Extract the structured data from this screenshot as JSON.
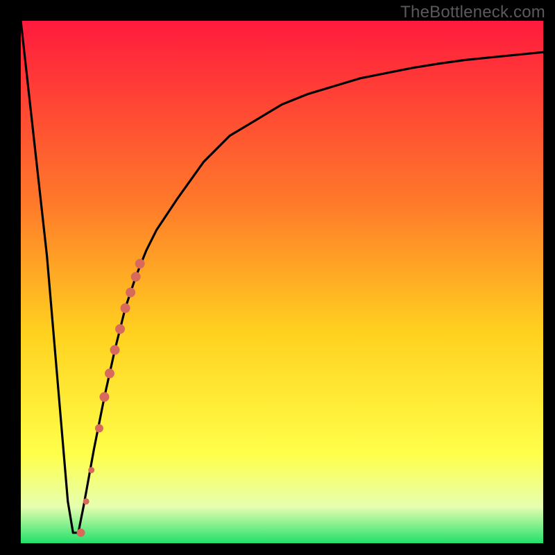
{
  "watermark": "TheBottleneck.com",
  "colors": {
    "frame": "#000000",
    "gradient_top": "#ff1a3d",
    "gradient_mid1": "#ff7a2a",
    "gradient_mid2": "#ffd21f",
    "gradient_mid3": "#ffff4a",
    "gradient_mid4": "#e6ffb0",
    "gradient_bottom": "#22e06a",
    "curve_stroke": "#000000",
    "marker_fill": "#d86a5c",
    "marker_stroke": "#d86a5c"
  },
  "chart_data": {
    "type": "line",
    "title": "",
    "xlabel": "",
    "ylabel": "",
    "xlim": [
      0,
      100
    ],
    "ylim": [
      0,
      100
    ],
    "grid": false,
    "legend": false,
    "series": [
      {
        "name": "bottleneck-curve",
        "x": [
          0,
          5,
          9,
          10,
          11,
          12,
          14,
          16,
          18,
          20,
          22,
          24,
          26,
          30,
          35,
          40,
          45,
          50,
          55,
          60,
          65,
          70,
          75,
          80,
          85,
          90,
          95,
          100
        ],
        "y": [
          100,
          55,
          8,
          2,
          2,
          7,
          18,
          28,
          37,
          45,
          51,
          56,
          60,
          66,
          73,
          78,
          81,
          84,
          86,
          87.5,
          89,
          90,
          91,
          91.8,
          92.5,
          93,
          93.5,
          94
        ]
      }
    ],
    "markers": {
      "name": "highlight-points",
      "x": [
        11.5,
        12.5,
        13.5,
        15.0,
        16.0,
        17.0,
        18.0,
        19.0,
        20.0,
        21.0,
        22.0,
        22.8
      ],
      "y": [
        2.0,
        8.0,
        14.0,
        22.0,
        28.0,
        32.5,
        37.0,
        41.0,
        45.0,
        48.0,
        51.0,
        53.5
      ],
      "size": [
        11,
        8,
        8,
        11,
        13,
        13,
        13,
        13,
        13,
        13,
        13,
        13
      ]
    }
  }
}
